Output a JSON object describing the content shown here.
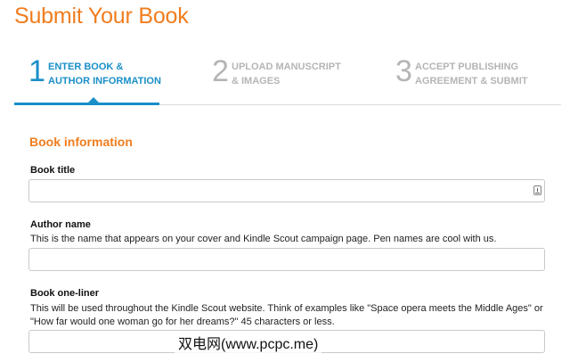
{
  "page": {
    "title": "Submit Your Book"
  },
  "steps": [
    {
      "number": "1",
      "line1": "ENTER BOOK &",
      "line2": "AUTHOR INFORMATION",
      "active": true
    },
    {
      "number": "2",
      "line1": "UPLOAD MANUSCRIPT",
      "line2": "& IMAGES",
      "active": false
    },
    {
      "number": "3",
      "line1": "ACCEPT PUBLISHING",
      "line2": "AGREEMENT & SUBMIT",
      "active": false
    }
  ],
  "section": {
    "title": "Book information"
  },
  "fields": {
    "book_title": {
      "label": "Book title",
      "value": ""
    },
    "author_name": {
      "label": "Author name",
      "help": "This is the name that appears on your cover and Kindle Scout campaign page. Pen names are cool with us.",
      "value": ""
    },
    "one_liner": {
      "label": "Book one-liner",
      "help_line1": "This will be used throughout the Kindle Scout website. Think of examples like \"Space opera meets the Middle Ages\" or",
      "help_line2": "\"How far would one woman go for her dreams?\" 45 characters or less.",
      "value": ""
    }
  },
  "watermark": "双电网(www.pcpc.me)",
  "colors": {
    "accent_orange": "#f07d1f",
    "accent_blue": "#1a8fc8",
    "inactive_gray": "#b5b5b5"
  },
  "icons": {
    "book_title_input_icon": "keychain-icon"
  }
}
